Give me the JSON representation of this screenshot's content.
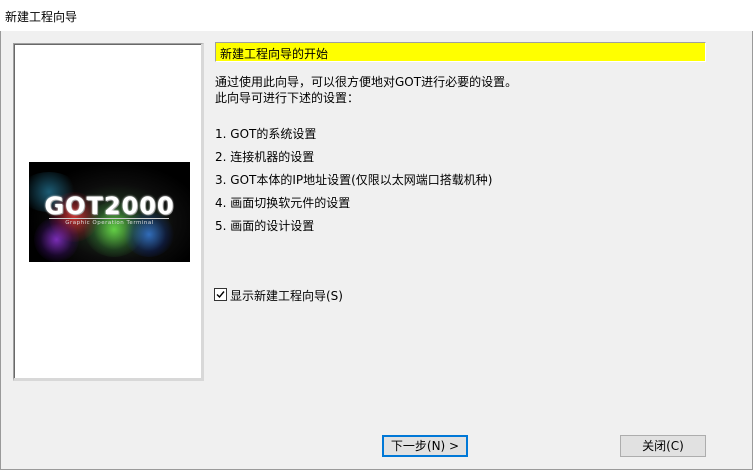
{
  "window": {
    "title": "新建工程向导"
  },
  "logo": {
    "brand": "GOT2000",
    "tagline": "Graphic Operation Terminal"
  },
  "header": {
    "title": "新建工程向导的开始"
  },
  "intro": [
    "通过使用此向导，可以很方便地对GOT进行必要的设置。",
    "此向导可进行下述的设置："
  ],
  "steps": [
    "1. GOT的系统设置",
    "2. 连接机器的设置",
    "3. GOT本体的IP地址设置(仅限以太网端口搭载机种)",
    "4. 画面切换软元件的设置",
    "5. 画面的设计设置"
  ],
  "checkbox": {
    "label": "显示新建工程向导(S)",
    "checked": true
  },
  "buttons": {
    "next": "下一步(N) >",
    "close": "关闭(C)"
  },
  "colors": {
    "header_bg": "#ffff00",
    "dialog_bg": "#f0f0f0",
    "default_button_border": "#0078d7"
  }
}
